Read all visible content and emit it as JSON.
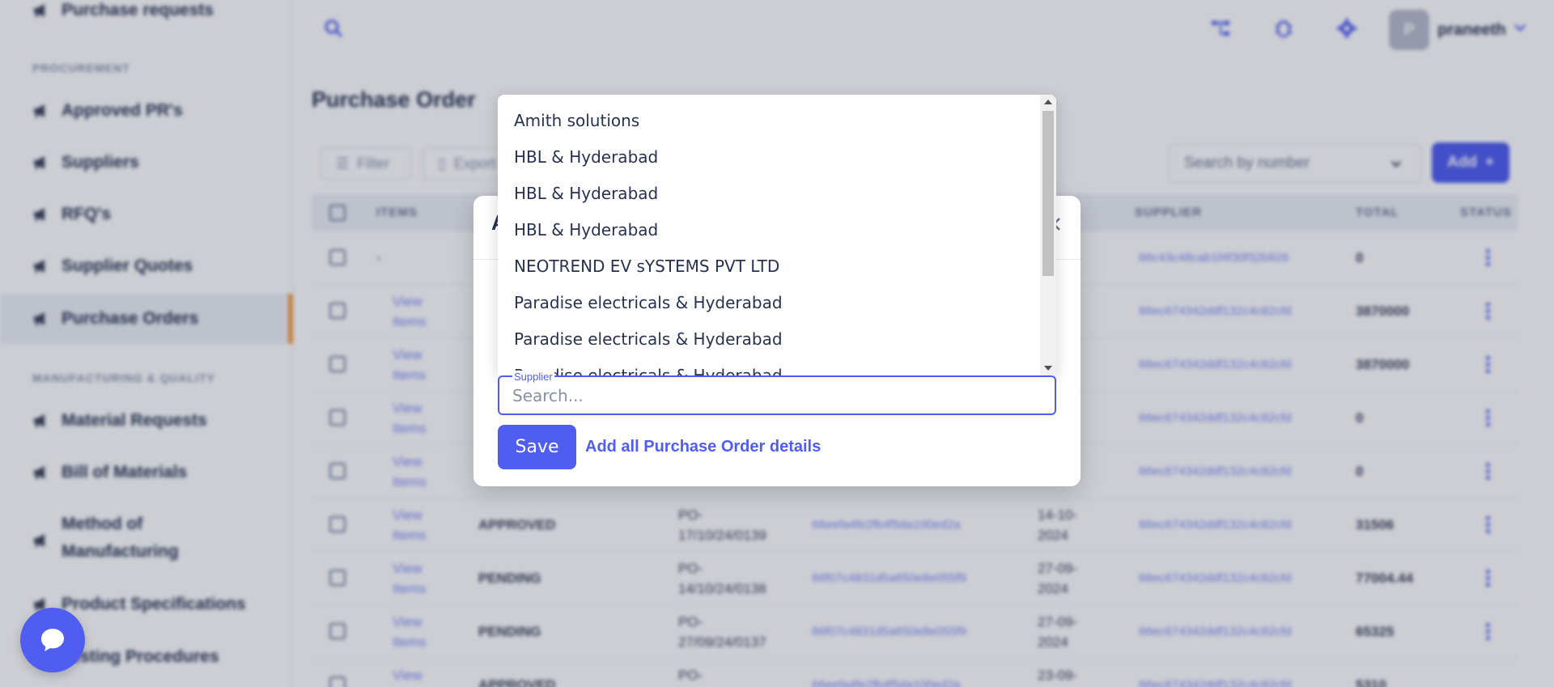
{
  "sidebar": {
    "items": [
      {
        "label": "Purchase requests"
      },
      {
        "label": "Approved PR's"
      },
      {
        "label": "Suppliers"
      },
      {
        "label": "RFQ's"
      },
      {
        "label": "Supplier Quotes"
      },
      {
        "label": "Purchase Orders"
      },
      {
        "label": "Material Requests"
      },
      {
        "label": "Bill of Materials"
      },
      {
        "label": "Method of Manufacturing"
      },
      {
        "label": "Product Specifications"
      },
      {
        "label": "Testing Procedures"
      }
    ],
    "sections": {
      "procurement": "PROCUREMENT",
      "manufacturing": "MANUFACTURING & QUALITY"
    },
    "active_item": "Purchase Orders",
    "accent_color": "#f59a3d"
  },
  "topbar": {
    "avatar_initial": "P",
    "username": "praneeth"
  },
  "page": {
    "title": "Purchase Order",
    "filter_label": "Filter",
    "export_label": "Export",
    "search_placeholder": "Search by number",
    "add_label": "Add"
  },
  "table": {
    "columns": [
      "ITEMS",
      "SUPPLIER",
      "TOTAL",
      "STATUS"
    ],
    "view_items_label": "View Items",
    "rows": [
      {
        "items": "-",
        "status": "",
        "po": "",
        "id1": "",
        "date": "",
        "supplier": "66c43c48cab1f4f30f32b926",
        "total": "0"
      },
      {
        "items": "View Items",
        "status": "",
        "po": "",
        "id1": "",
        "date": "",
        "supplier": "66ec674342ddf132c4c82cfd",
        "total": "3870000"
      },
      {
        "items": "View Items",
        "status": "",
        "po": "",
        "id1": "",
        "date": "",
        "supplier": "66ec674342ddf132c4c82cfd",
        "total": "3870000"
      },
      {
        "items": "View Items",
        "status": "",
        "po": "",
        "id1": "",
        "date": "",
        "supplier": "66ec674342ddf132c4c82cfd",
        "total": "0"
      },
      {
        "items": "View Items",
        "status": "",
        "po": "",
        "id1": "",
        "date": "",
        "supplier": "66ec674342ddf132c4c82cfd",
        "total": "0"
      },
      {
        "items": "View Items",
        "status": "APPROVED",
        "po": "PO-17/10/24/0139",
        "id1": "66eefa4fe2fb4f5da100ed2a",
        "date": "14-10-2024",
        "supplier": "66ec674342ddf132c4c82cfd",
        "total": "31506"
      },
      {
        "items": "View Items",
        "status": "PENDING",
        "po": "PO-14/10/24/0138",
        "id1": "66f07c4831d5a650e8e055f9",
        "date": "27-09-2024",
        "supplier": "66ec674342ddf132c4c82cfd",
        "total": "77004.44"
      },
      {
        "items": "View Items",
        "status": "PENDING",
        "po": "PO-27/09/24/0137",
        "id1": "66f07c4831d5a650e8e055f9",
        "date": "27-09-2024",
        "supplier": "66ec674342ddf132c4c82cfd",
        "total": "65325"
      },
      {
        "items": "View",
        "status": "APPROVED",
        "po": "PO-",
        "id1": "66eefa4fe2fb4f5da100ed2a",
        "date": "23-09-",
        "supplier": "66ec674342ddf132c4c82cfd",
        "total": "5310"
      }
    ]
  },
  "modal": {
    "title_visible": "A",
    "supplier_label": "Supplier",
    "search_placeholder": "Search...",
    "save_label": "Save",
    "add_all_label": "Add all Purchase Order details",
    "options": [
      "Amith solutions",
      "HBL & Hyderabad",
      "HBL & Hyderabad",
      "HBL & Hyderabad",
      "NEOTREND EV sYSTEMS PVT LTD",
      "Paradise electricals & Hyderabad",
      "Paradise electricals & Hyderabad",
      "Paradise electricals & Hyderabad"
    ]
  },
  "colors": {
    "primary": "#4f5df0",
    "text_dark": "#27324f",
    "accent": "#f59a3d"
  }
}
